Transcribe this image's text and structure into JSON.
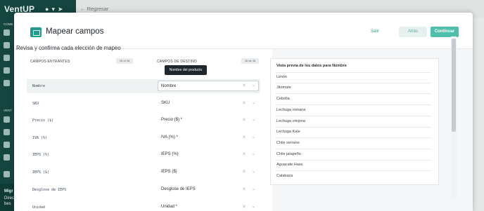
{
  "app": {
    "brand": "VentUP",
    "back_link": "← Regresar",
    "sidebar_sections": [
      "COME",
      "VENT"
    ],
    "sidebar_bottom": [
      "Migr",
      "Direc",
      "bes"
    ]
  },
  "modal": {
    "title": "Mapear campos",
    "icon": "mapping-icon",
    "buttons": {
      "exit": "Salir",
      "back": "Atrás",
      "continue": "Continuar"
    },
    "colors": {
      "accent": "#4ebfab",
      "accent_dark": "#1f9c8c"
    }
  },
  "mapping": {
    "heading": "Revisa y confirma cada elección de mapeo",
    "incoming_header": "CAMPOS ENTRANTES",
    "incoming_count": "16 of 16",
    "destination_header": "CAMPOS DE DESTINO",
    "destination_count": "16 de 16",
    "tooltip": "Nombre del producto",
    "rows": [
      {
        "incoming": "Nombre",
        "destination": "Nombre"
      },
      {
        "incoming": "SKU",
        "destination": "SKU"
      },
      {
        "incoming": "Precio ($)",
        "destination": "Precio ($) *"
      },
      {
        "incoming": "IVA (%)",
        "destination": "IVA (%) *"
      },
      {
        "incoming": "IEPS (%)",
        "destination": "IEPS (%)"
      },
      {
        "incoming": "IEPS ($)",
        "destination": "IEPS ($)"
      },
      {
        "incoming": "Desglose de IEPS",
        "destination": "Desglose de IEPS"
      },
      {
        "incoming": "Unidad",
        "destination": "Unidad *"
      }
    ]
  },
  "preview": {
    "title": "Vista previa de los datos para Nombre",
    "items": [
      "Limón",
      "Jitomate",
      "Cebolla",
      "Lechuga romana",
      "Lechuga orejona",
      "Lechuga Kale",
      "Chile serrano",
      "Chile jalapeño",
      "Aguacate Hass",
      "Calabaza"
    ]
  }
}
